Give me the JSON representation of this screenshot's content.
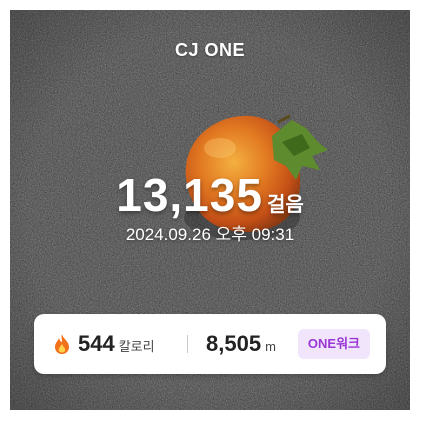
{
  "brand": "CJ ONE",
  "steps": {
    "count": "13,135",
    "unit": "걸음"
  },
  "datetime": "2024.09.26 오후 09:31",
  "stats": {
    "calories": {
      "value": "544",
      "unit": "칼로리",
      "icon": "flame-icon"
    },
    "distance": {
      "value": "8,505",
      "unit": "m"
    },
    "walk_button": "ONE워크"
  },
  "colors": {
    "accent": "#9b36d6",
    "accent_bg": "#f1e5fb",
    "flame": "#f2721c"
  }
}
